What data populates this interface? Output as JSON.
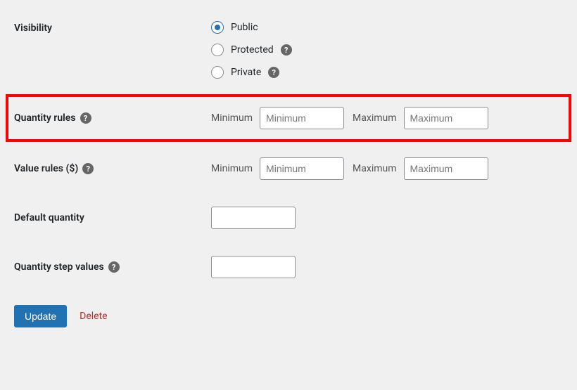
{
  "visibility": {
    "label": "Visibility",
    "options": [
      {
        "label": "Public",
        "checked": true,
        "help": false
      },
      {
        "label": "Protected",
        "checked": false,
        "help": true
      },
      {
        "label": "Private",
        "checked": false,
        "help": true
      }
    ]
  },
  "quantity_rules": {
    "label": "Quantity rules",
    "min_label": "Minimum",
    "min_placeholder": "Minimum",
    "max_label": "Maximum",
    "max_placeholder": "Maximum"
  },
  "value_rules": {
    "label": "Value rules ($)",
    "min_label": "Minimum",
    "min_placeholder": "Minimum",
    "max_label": "Maximum",
    "max_placeholder": "Maximum"
  },
  "default_quantity": {
    "label": "Default quantity"
  },
  "quantity_step": {
    "label": "Quantity step values"
  },
  "actions": {
    "update": "Update",
    "delete": "Delete"
  },
  "help_glyph": "?"
}
